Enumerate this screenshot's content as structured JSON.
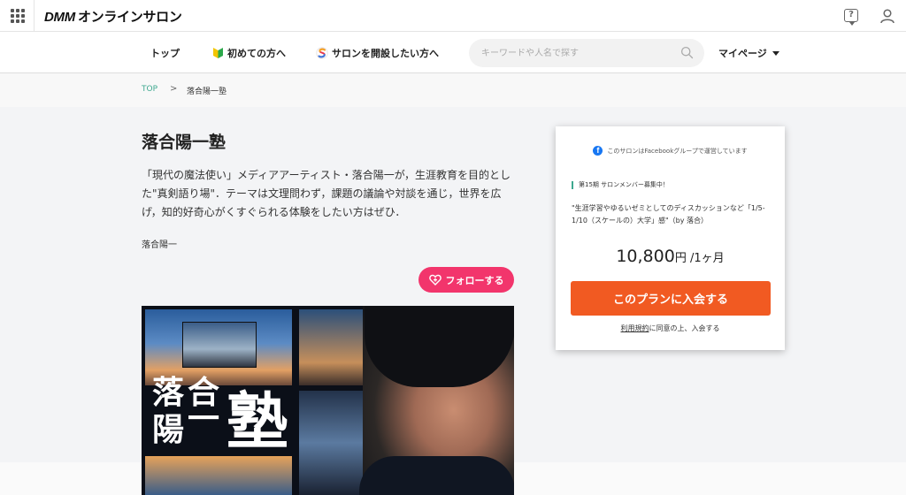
{
  "topbar": {
    "logo_brand": "DMM",
    "logo_text": "オンラインサロン",
    "help_glyph": "?",
    "icons": [
      "grid-menu-icon",
      "help-icon",
      "user-icon"
    ]
  },
  "nav": {
    "top": "トップ",
    "beginner": "初めての方へ",
    "open_salon": "サロンを開設したい方へ",
    "search_placeholder": "キーワードや人名で探す",
    "mypage": "マイページ"
  },
  "breadcrumb": {
    "root": "TOP",
    "separator": ">",
    "current": "落合陽一塾"
  },
  "salon": {
    "title": "落合陽一塾",
    "description": "「現代の魔法使い」メディアアーティスト・落合陽一が，生涯教育を目的とした\"真剣語り場\"．テーマは文理問わず，課題の議論や対談を通じ，世界を広げ，知的好奇心がくすぐられる体験をしたい方はぜひ．",
    "owner": "落合陽一",
    "follow_label": "フォローする",
    "hero_kanji": [
      "落",
      "合",
      "陽",
      "一",
      "塾"
    ]
  },
  "plan": {
    "facebook_note": "このサロンはFacebookグループで運営しています",
    "tag": "第15期 サロンメンバー募集中！",
    "description": "\"生涯学習やゆるいゼミとしてのディスカッションなど「1/5-1/10（スケールの）大学」感\"（by 落合）",
    "price": "10,800",
    "price_yen": "円",
    "price_period": " /1ヶ月",
    "join_label": "このプランに入会する",
    "terms_link": "利用規約",
    "terms_suffix": "に同意の上、入会する"
  },
  "colors": {
    "accent_green": "#3ea88f",
    "follow_pink": "#f2356c",
    "join_orange": "#f15a22",
    "facebook_blue": "#1877f2"
  }
}
